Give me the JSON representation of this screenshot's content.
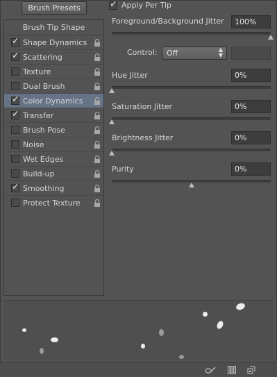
{
  "presets_button": "Brush Presets",
  "left_panel": {
    "header": "Brush Tip Shape",
    "items": [
      {
        "label": "Shape Dynamics",
        "checked": true,
        "selected": false
      },
      {
        "label": "Scattering",
        "checked": true,
        "selected": false
      },
      {
        "label": "Texture",
        "checked": false,
        "selected": false
      },
      {
        "label": "Dual Brush",
        "checked": false,
        "selected": false
      },
      {
        "label": "Color Dynamics",
        "checked": true,
        "selected": true
      },
      {
        "label": "Transfer",
        "checked": true,
        "selected": false
      },
      {
        "label": "Brush Pose",
        "checked": false,
        "selected": false
      },
      {
        "label": "Noise",
        "checked": false,
        "selected": false
      },
      {
        "label": "Wet Edges",
        "checked": false,
        "selected": false
      },
      {
        "label": "Build-up",
        "checked": false,
        "selected": false
      },
      {
        "label": "Smoothing",
        "checked": true,
        "selected": false
      },
      {
        "label": "Protect Texture",
        "checked": false,
        "selected": false
      }
    ]
  },
  "apply_per_tip": {
    "label": "Apply Per Tip",
    "checked": true
  },
  "fg_bg_jitter": {
    "label": "Foreground/Background Jitter",
    "value": "100%",
    "level": 1.0
  },
  "control": {
    "label": "Control:",
    "value": "Off"
  },
  "hue_jitter": {
    "label": "Hue Jitter",
    "value": "0%",
    "level": 0.0
  },
  "saturation_jitter": {
    "label": "Saturation Jitter",
    "value": "0%",
    "level": 0.0
  },
  "brightness_jitter": {
    "label": "Brightness Jitter",
    "value": "0%",
    "level": 0.0
  },
  "purity": {
    "label": "Purity",
    "value": "0%",
    "level": 0.5
  },
  "colors": {
    "panel_bg": "#535353",
    "selected_row": "#667286",
    "field_bg": "#3d3d3d"
  },
  "icons": [
    "lock-icon",
    "checkmark-icon",
    "create-new-brush-icon",
    "new-preset-icon",
    "grid-icon"
  ]
}
